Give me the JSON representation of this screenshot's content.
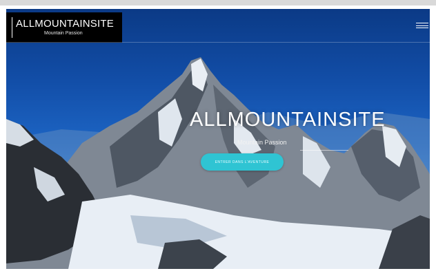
{
  "site": {
    "logo_title": "ALLMOUNTAINSITE",
    "logo_subtitle": "Mountain Passion"
  },
  "hero": {
    "title": "ALLMOUNTAINSITE",
    "subtitle": "Mountain Passion",
    "cta_label": "ENTRER DANS L'AVENTURE"
  },
  "icons": {
    "menu": "hamburger-menu-icon"
  },
  "colors": {
    "sky_top": "#0b3a86",
    "sky_bottom": "#3c86d6",
    "cta": "#2fc4d3",
    "logo_bg": "#000000"
  }
}
